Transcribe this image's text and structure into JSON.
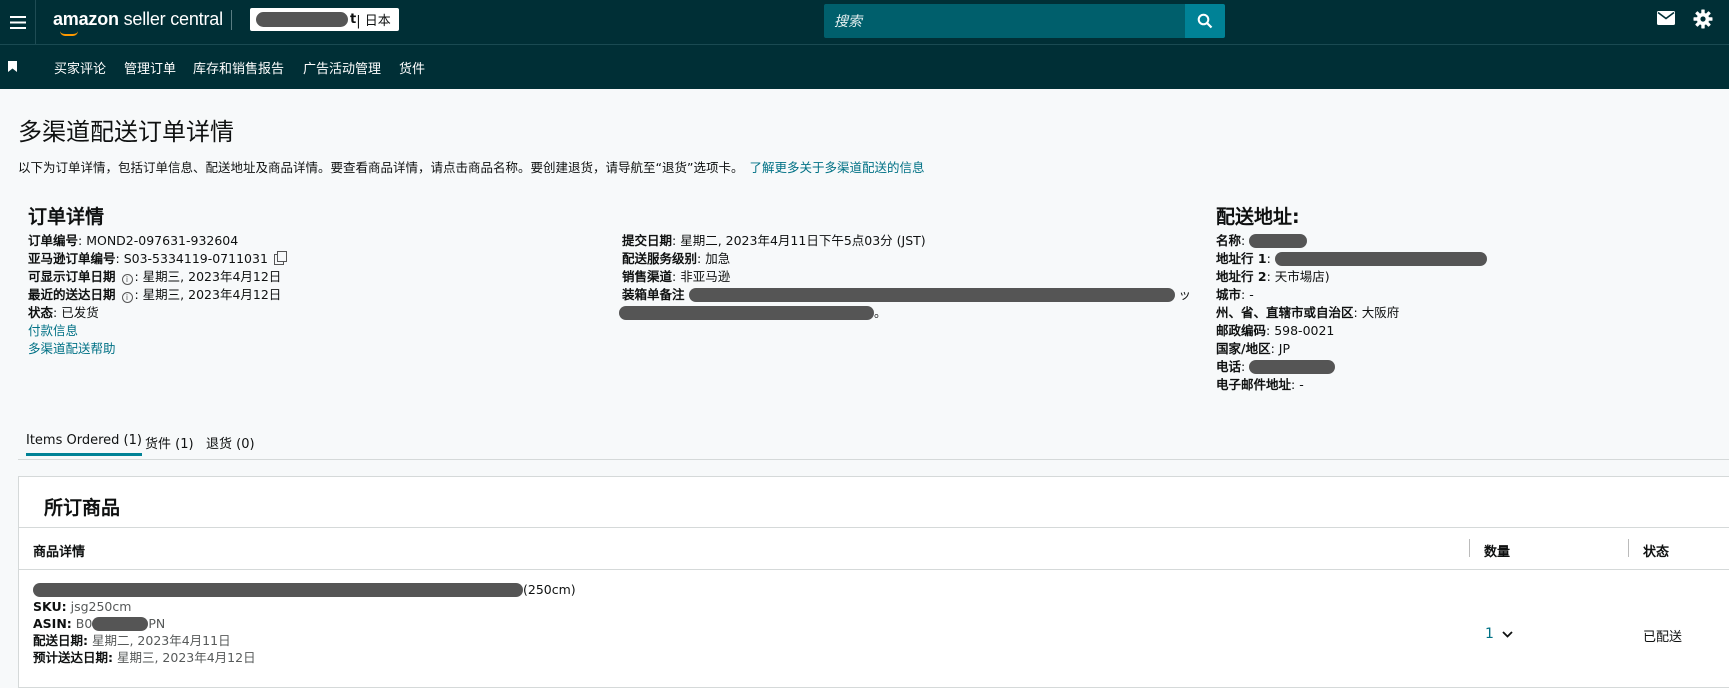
{
  "header": {
    "logo_bold": "amazon",
    "logo_light": " seller central",
    "store_tail": "t",
    "store_country": " | 日本",
    "search_placeholder": "搜索",
    "icons": [
      "menu-icon",
      "search-icon",
      "mail-icon",
      "gear-icon"
    ]
  },
  "subnav": {
    "items": [
      "买家评论",
      "管理订单",
      "库存和销售报告",
      "广告活动管理",
      "货件"
    ]
  },
  "page": {
    "title": "多渠道配送订单详情",
    "intro": "以下为订单详情，包括订单信息、配送地址及商品详情。要查看商品详情，请点击商品名称。要创建退货，请导航至“退货”选项卡。",
    "intro_link": "了解更多关于多渠道配送的信息"
  },
  "order": {
    "heading": "订单详情",
    "order_no_label": "订单编号",
    "order_no": ": MOND2-097631-932604",
    "amazon_no_label": "亚马逊订单编号",
    "amazon_no": ": S03-5334119-0711031",
    "display_date_label": "可显示订单日期",
    "display_date": ": 星期三, 2023年4月12日",
    "latest_delivery_label": "最近的送达日期",
    "latest_delivery": ": 星期三, 2023年4月12日",
    "status_label": "状态",
    "status": ": 已发货",
    "payment_link": "付款信息",
    "help_link": "多渠道配送帮助",
    "submit_date_label": "提交日期",
    "submit_date": ": 星期二, 2023年4月11日下午5点03分 (JST)",
    "service_level_label": "配送服务级别",
    "service_level": ": 加急",
    "channel_label": "销售渠道",
    "channel": ": 非亚马逊",
    "packing_note_label": "装箱单备注",
    "packing_note_tail1": "ッ",
    "packing_note_tail2": "。"
  },
  "address": {
    "heading": "配送地址:",
    "name_label": "名称",
    "line1_label": "地址行 1",
    "line2_label": "地址行 2",
    "line2": ": 天市場店)",
    "city_label": "城市",
    "city": ": -",
    "state_label": "州、省、直辖市或自治区",
    "state": ": 大阪府",
    "postal_label": "邮政编码",
    "postal": ": 598-0021",
    "country_label": "国家/地区",
    "country": ": JP",
    "phone_label": "电话",
    "email_label": "电子邮件地址",
    "email": ": -"
  },
  "tabs": [
    "Items Ordered (1)",
    "货件 (1)",
    "退货 (0)"
  ],
  "items": {
    "title": "所订商品",
    "col_details": "商品详情",
    "col_qty": "数量",
    "col_status": "状态",
    "row": {
      "name_tail": "(250cm)",
      "sku_label": "SKU:",
      "sku": " jsg250cm",
      "asin_label": "ASIN:",
      "asin_head": " B0",
      "asin_tail": "PN",
      "ship_date_label": "配送日期:",
      "ship_date": " 星期二, 2023年4月11日",
      "est_date_label": "预计送达日期:",
      "est_date": " 星期三, 2023年4月12日",
      "qty": "1",
      "status": "已配送"
    }
  }
}
